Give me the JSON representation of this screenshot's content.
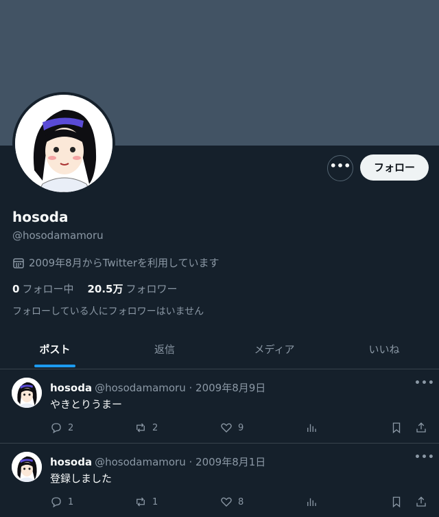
{
  "profile": {
    "name": "hosoda",
    "handle": "@hosodamamoru",
    "joined": "2009年8月からTwitterを利用しています",
    "following_count": "0",
    "following_label": "フォロー中",
    "followers_count": "20.5万",
    "followers_label": "フォロワー",
    "no_mutuals": "フォローしている人にフォロワーはいません"
  },
  "buttons": {
    "more": "•••",
    "follow": "フォロー"
  },
  "tabs": [
    {
      "label": "ポスト",
      "active": true
    },
    {
      "label": "返信"
    },
    {
      "label": "メディア"
    },
    {
      "label": "いいね"
    }
  ],
  "posts": [
    {
      "name": "hosoda",
      "handle": "@hosodamamoru",
      "date": "2009年8月9日",
      "text": "やきとりうまー",
      "replies": "2",
      "reposts": "2",
      "likes": "9"
    },
    {
      "name": "hosoda",
      "handle": "@hosodamamoru",
      "date": "2009年8月1日",
      "text": "登録しました",
      "replies": "1",
      "reposts": "1",
      "likes": "8"
    }
  ],
  "colors": {
    "background": "#15202b",
    "banner": "#425364",
    "accent": "#1d9bf0",
    "muted": "#8b98a5"
  },
  "icons": [
    "calendar-icon",
    "more-icon",
    "reply-icon",
    "repost-icon",
    "like-icon",
    "views-icon",
    "bookmark-icon",
    "share-icon"
  ]
}
